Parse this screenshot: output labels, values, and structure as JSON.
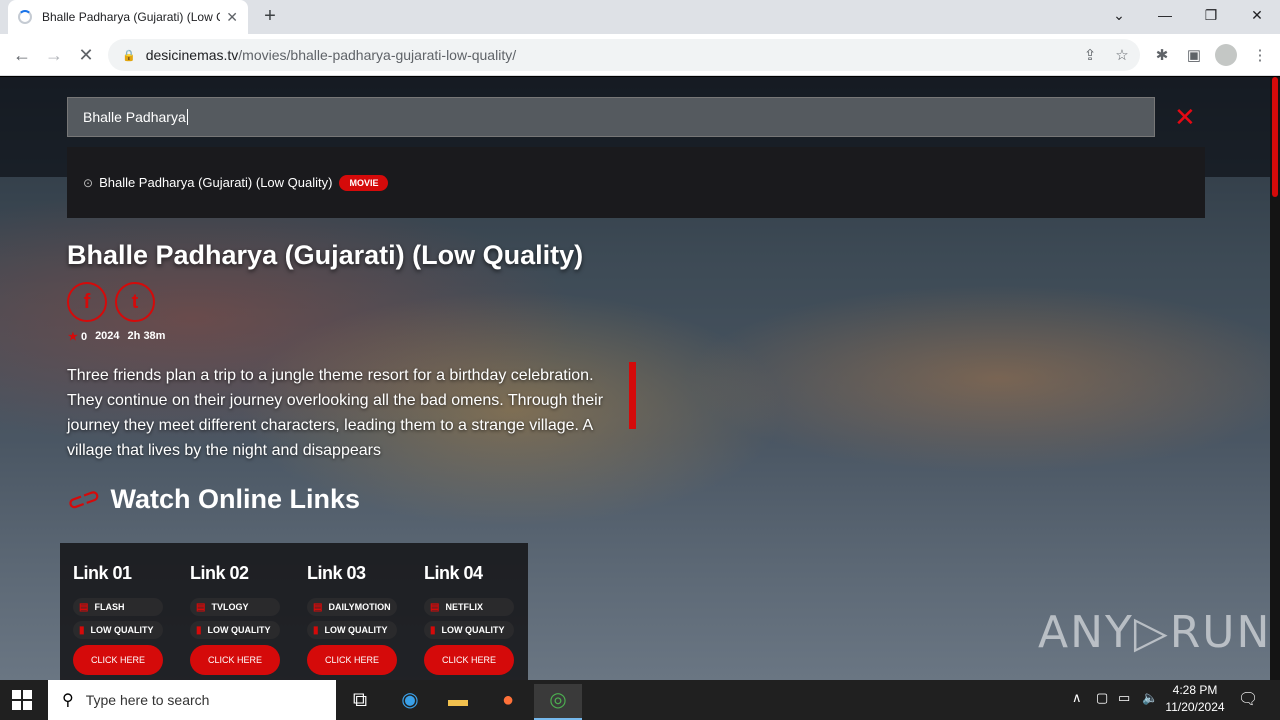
{
  "browser": {
    "tab_title": "Bhalle Padharya (Gujarati) (Low Q",
    "tab_close": "✕",
    "new_tab": "+",
    "url_host": "desicinemas.tv",
    "url_path": "/movies/bhalle-padharya-gujarati-low-quality/",
    "window_controls": [
      "⌄",
      "—",
      "❐",
      "✕"
    ]
  },
  "search": {
    "value": "Bhalle Padharya",
    "close": "✕",
    "result_label": "Bhalle Padharya (Gujarati) (Low Quality)",
    "result_badge": "MOVIE"
  },
  "movie": {
    "title": "Bhalle Padharya (Gujarati) (Low Quality)",
    "rating": "0",
    "year": "2024",
    "duration": "2h 38m",
    "description": "Three friends plan a trip to a jungle theme resort for a birthday celebration. They continue on their journey overlooking all the bad omens. Through their journey they meet different characters, leading them to a strange village. A village that lives by the night and disappears",
    "social": [
      "f",
      "t"
    ]
  },
  "watch": {
    "heading": "Watch Online Links",
    "links": [
      {
        "name": "Link 01",
        "source": "FLASH",
        "quality": "LOW QUALITY",
        "button": "CLICK HERE"
      },
      {
        "name": "Link 02",
        "source": "TVLOGY",
        "quality": "LOW QUALITY",
        "button": "CLICK HERE"
      },
      {
        "name": "Link 03",
        "source": "DAILYMOTION",
        "quality": "LOW QUALITY",
        "button": "CLICK HERE"
      },
      {
        "name": "Link 04",
        "source": "NETFLIX",
        "quality": "LOW QUALITY",
        "button": "CLICK HERE"
      }
    ]
  },
  "watermark": "ANY▷RUN",
  "taskbar": {
    "search_placeholder": "Type here to search",
    "time": "4:28 PM",
    "date": "11/20/2024"
  },
  "colors": {
    "accent": "#d50a0a"
  }
}
